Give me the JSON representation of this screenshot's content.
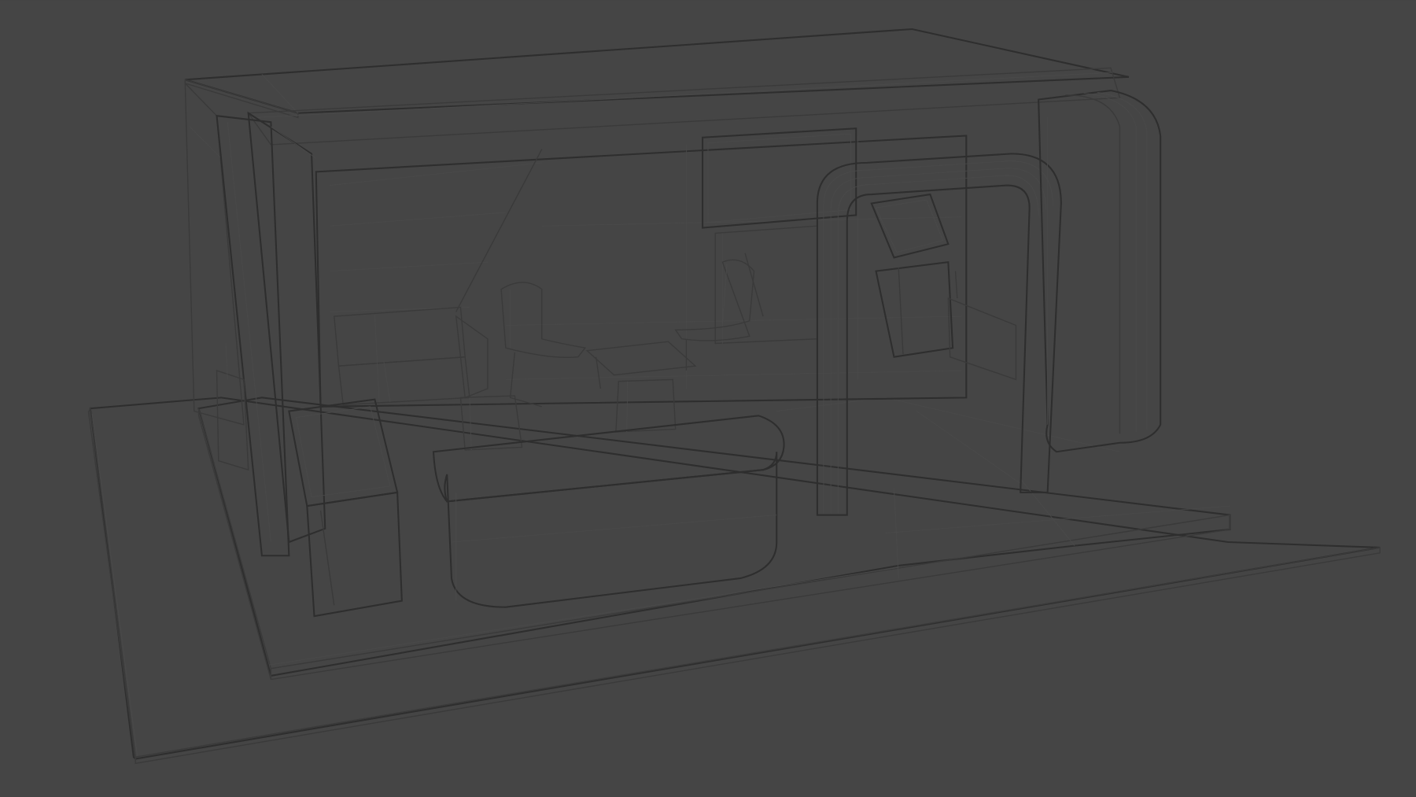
{
  "viewport": {
    "background_color": "#454545",
    "model_color": "#8f8f8f",
    "model_light_color": "#9d9d9d",
    "model_dark_color": "#7a7a7a",
    "wire_color": "#3a3a3a"
  }
}
